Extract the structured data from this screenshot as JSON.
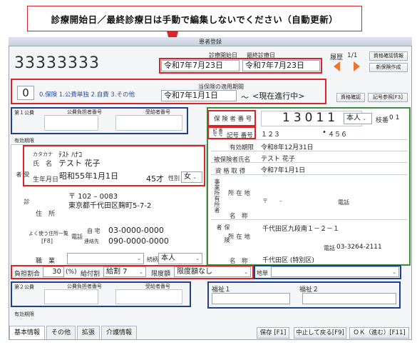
{
  "callout": {
    "text": "診療開始日／最終診療日は手動で編集しないでください（自動更新）"
  },
  "window": {
    "title": "患者登録"
  },
  "header": {
    "patient_id": "33333333",
    "start_date_label": "診療開始日",
    "last_date_label": "最終診療日",
    "start_date": "令和7年7月23日",
    "last_date": "令和7年7月23日",
    "history_label": "履歴",
    "history_page": "1/1",
    "eligibility_info": "資格確認情報",
    "new_insurance": "新保険作成"
  },
  "insurance_type": {
    "code": "0",
    "options": "0.保険 1.公費単独 2.自費 3.その他",
    "period_label": "当保険の適用期間",
    "period_start": "令和7年1月1日",
    "tilde": "～",
    "period_end": "<現在進行中>",
    "eligibility_button": "資格確認",
    "code_ref_button": "記号参照[F3]"
  },
  "public1": {
    "label": "第１公費",
    "payer_label": "公費負担者番号",
    "recipient_label": "受給者番号",
    "valid_label": "有効期限"
  },
  "insurer": {
    "insurer_no_label": "保 険 者 番 号",
    "insurer_no": "13011",
    "relation": "本人",
    "branch_label": "枝番",
    "branch": "01",
    "kigo_label": "記号 番号",
    "kigo": "１２３",
    "dot": "•",
    "bango": "４５６",
    "valid_label": "有効期限",
    "valid": "令和8年12月31日",
    "insured_name_label": "被保険者氏名",
    "insured_name": "テスト 花子",
    "acquired_label": "資 格 取 得",
    "acquired": "令和7年1月1日",
    "side1": "記号",
    "side2": "番号"
  },
  "patient": {
    "section": "受診者",
    "kana_label": "カタカナ",
    "kana": "ﾃｽﾄ ﾊﾅｺ",
    "name_label": "氏　名",
    "name": "テスト 花子",
    "birth_label": "生年月日",
    "birth": "昭和55年1月1日",
    "age": "45才",
    "sex_label": "性別",
    "sex": "女",
    "addr_label": "住　所",
    "postal": "〒 102 – 0083",
    "address": "東京都千代田区麹町5-7-2",
    "addr_list_label": "よく使う住所一覧",
    "addr_list_key": "[F8]",
    "phone_label": "電話",
    "home_label": "自 宅",
    "home_phone": "03-0000-0000",
    "contact_label": "連絡先",
    "contact_phone": "090-0000-0000",
    "job_label": "職　業",
    "relation_label": "続柄",
    "relation": "本人"
  },
  "employer": {
    "label": "事業所有所者",
    "addr_label": "所 在 地",
    "postal": "〒　　–",
    "phone_label": "電話",
    "name_label": "名　称",
    "ins_label": "保険者",
    "ins_addr": "千代田区九段南１－２－１",
    "ins_phone_label": "電話",
    "ins_phone": "03-3264-2111",
    "ins_name": "千代田区 (特別区)"
  },
  "burden": {
    "rate_label": "負担割合",
    "rate": "30",
    "unit": "(%)",
    "benefit_label": "給付割",
    "benefit": "給割 7",
    "limit_label": "限度額",
    "limit": "限度額なし",
    "area_label": "地単"
  },
  "public2": {
    "label": "第２公費",
    "payer_label": "公費負担者番号",
    "recipient_label": "受給者番号",
    "valid_label": "有効期限"
  },
  "welfare": {
    "label1": "福祉１",
    "label2": "福祉２"
  },
  "tabs": [
    "基本情報",
    "その他",
    "拡張",
    "介護情報"
  ],
  "buttons": {
    "save": "保存 [F1]",
    "cancel": "中止して戻る[F9]",
    "ok": "ＯＫ（進む）[F11]"
  }
}
